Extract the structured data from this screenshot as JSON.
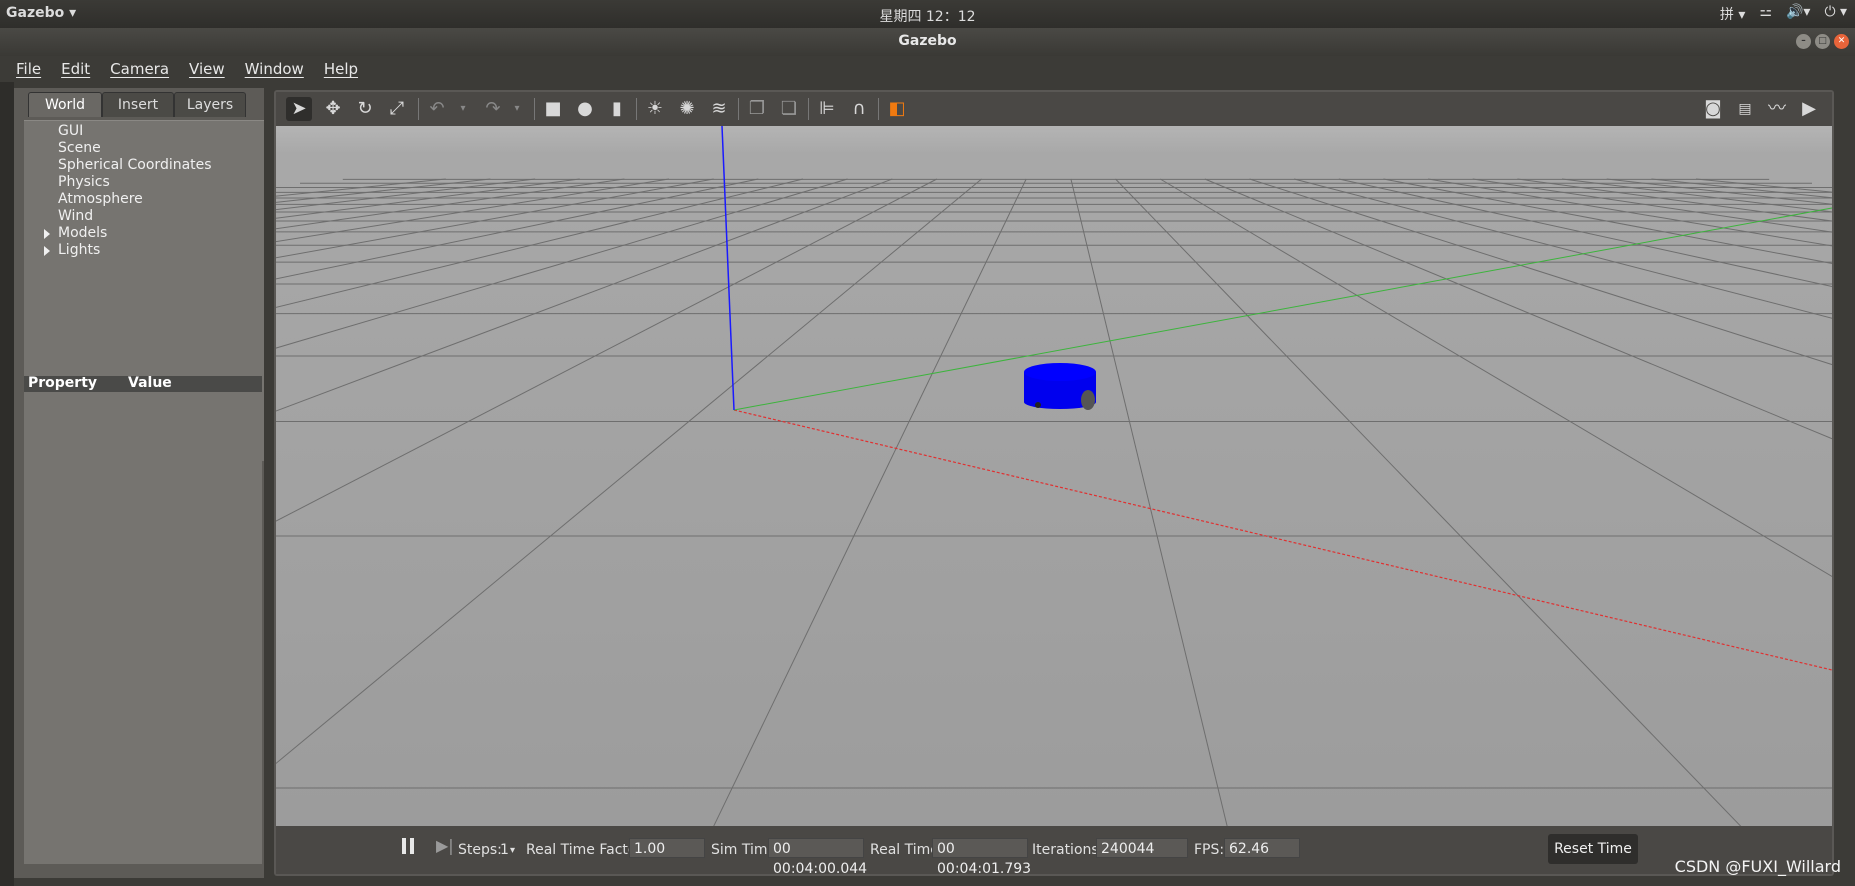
{
  "topbar": {
    "app": "Gazebo ▾",
    "clock": "星期四 12：12",
    "tray": [
      "拼 ▾",
      "⚍",
      "🔊▾",
      "⏻ ▾"
    ]
  },
  "window": {
    "title": "Gazebo"
  },
  "menu": [
    "File",
    "Edit",
    "Camera",
    "View",
    "Window",
    "Help"
  ],
  "tabs": [
    "World",
    "Insert",
    "Layers"
  ],
  "tree": [
    "GUI",
    "Scene",
    "Spherical Coordinates",
    "Physics",
    "Atmosphere",
    "Wind",
    "Models",
    "Lights"
  ],
  "props": {
    "property": "Property",
    "value": "Value"
  },
  "status": {
    "steps_label": "Steps:",
    "steps_value": "1",
    "rtf_label": "Real Time Factor:",
    "rtf_value": "1.00",
    "sim_label": "Sim Time:",
    "sim_value": "00 00:04:00.044",
    "real_label": "Real Time:",
    "real_value": "00 00:04:01.793",
    "iter_label": "Iterations:",
    "iter_value": "240044",
    "fps_label": "FPS:",
    "fps_value": "62.46",
    "reset": "Reset Time"
  },
  "watermark": "CSDN @FUXI_Willard",
  "colors": {
    "z_axis": "#1a1aff",
    "y_axis": "#3cb43c",
    "x_axis": "#e03030",
    "robot": "#0000ee"
  }
}
